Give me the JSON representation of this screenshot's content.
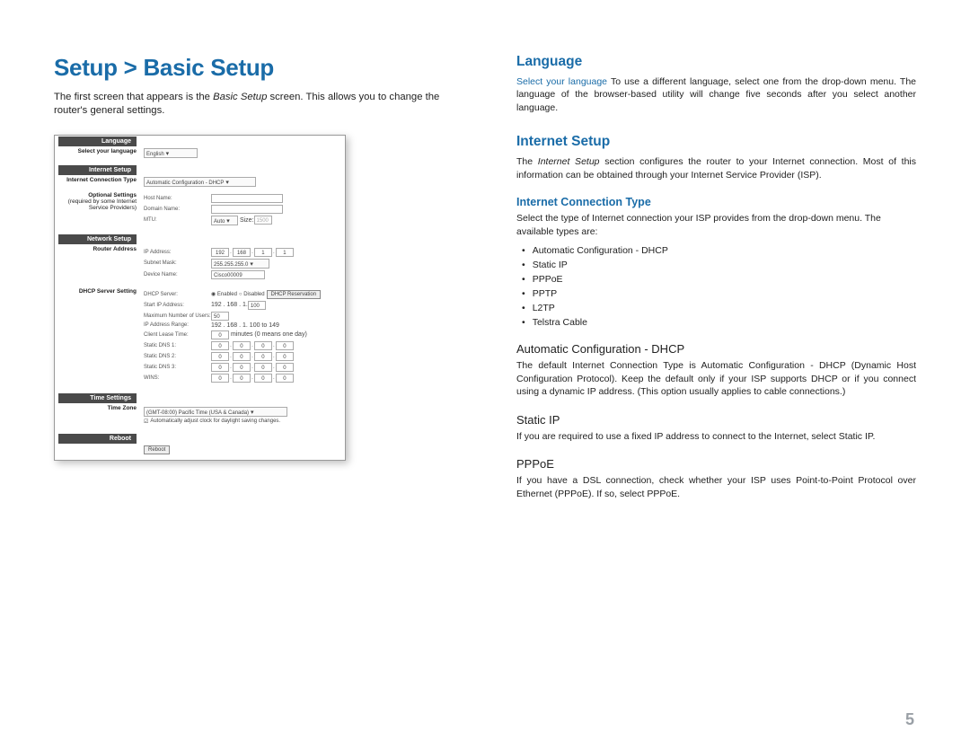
{
  "page_number": "5",
  "left": {
    "title": "Setup > Basic Setup",
    "intro_a": "The first screen that appears is the ",
    "intro_em": "Basic Setup",
    "intro_b": " screen. This allows you to change the router's general settings.",
    "ss": {
      "sections": {
        "language": "Language",
        "internet_setup": "Internet Setup",
        "network_setup": "Network Setup",
        "time_settings": "Time Settings",
        "reboot": "Reboot"
      },
      "labels": {
        "select_lang": "Select your language",
        "conn_type": "Internet Connection Type",
        "optional": "Optional Settings",
        "optional2": "(required by some Internet Service Providers)",
        "router_addr": "Router Address",
        "dhcp_srv": "DHCP Server Setting",
        "time_zone": "Time Zone"
      },
      "values": {
        "english": "English",
        "auto_dhcp": "Automatic Configuration - DHCP",
        "host_name": "Host Name:",
        "domain_name": "Domain Name:",
        "mtu": "MTU:",
        "mtu_mode": "Auto",
        "mtu_size_l": "Size:",
        "mtu_size": "1500",
        "ip_addr": "IP Address:",
        "ip": [
          "192",
          "168",
          "1",
          "1"
        ],
        "subnet": "Subnet Mask:",
        "subnet_v": "255.255.255.0",
        "device_name": "Device Name:",
        "device_v": "Cisco00009",
        "dhcp_server": "DHCP Server:",
        "enabled": "Enabled",
        "disabled": "Disabled",
        "dhcp_res": "DHCP Reservation",
        "start_ip": "Start IP Address:",
        "start_ip_v": "192 . 168 . 1.",
        "start_ip_last": "100",
        "max_users": "Maximum Number of Users:",
        "max_users_v": "50",
        "ip_range": "IP Address Range:",
        "ip_range_v": "192 . 168 . 1. 100 to 149",
        "lease": "Client Lease Time:",
        "lease_v": "0",
        "lease_note": "minutes (0 means one day)",
        "dns1": "Static DNS 1:",
        "dns2": "Static DNS 2:",
        "dns3": "Static DNS 3:",
        "wins": "WINS:",
        "zero": "0",
        "tz": "(GMT-08:00) Pacific Time (USA & Canada)",
        "dst": "Automatically adjust clock for daylight saving changes.",
        "reboot_btn": "Reboot"
      }
    }
  },
  "right": {
    "language": {
      "title": "Language",
      "lead": "Select your language",
      "text": " To use a different language, select one from the drop-down menu. The language of the browser-based utility will change five seconds after you select another language."
    },
    "internet": {
      "title": "Internet Setup",
      "text_a": "The ",
      "text_em": "Internet Setup",
      "text_b": " section configures the router to your Internet connection. Most of this information can be obtained through your Internet Service Provider (ISP).",
      "conn_h": "Internet Connection Type",
      "conn_text": "Select the type of Internet connection your ISP provides from the drop-down menu. The available types are:",
      "types": [
        "Automatic Configuration - DHCP",
        "Static IP",
        "PPPoE",
        "PPTP",
        "L2TP",
        "Telstra Cable"
      ],
      "dhcp_h": "Automatic Configuration - DHCP",
      "dhcp_text": "The default Internet Connection Type is Automatic Configuration - DHCP (Dynamic Host Configuration Protocol). Keep the default only if your ISP supports DHCP or if you connect using a dynamic IP address. (This option usually applies to cable connections.)",
      "static_h": "Static IP",
      "static_text": "If you are required to use a fixed IP address to connect to the Internet, select Static IP.",
      "pppoe_h": "PPPoE",
      "pppoe_text": "If you have a DSL connection, check whether your ISP uses Point-to-Point Protocol over Ethernet (PPPoE). If so, select PPPoE."
    }
  }
}
